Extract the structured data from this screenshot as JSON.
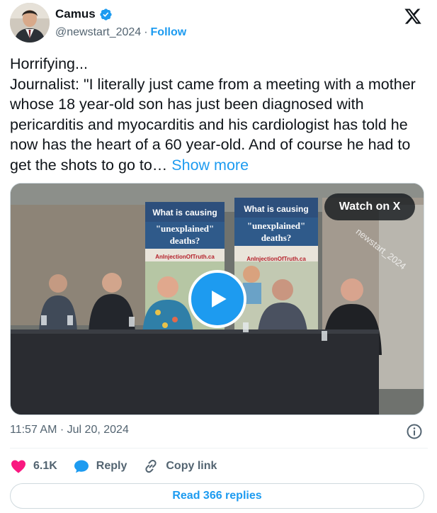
{
  "author": {
    "name": "Camus",
    "handle": "@newstart_2024",
    "separator": "·",
    "follow_label": "Follow"
  },
  "tweet": {
    "line1": "Horrifying...",
    "body": "Journalist: \"I literally just came from a meeting with a mother whose 18 year-old son has just been diagnosed with pericarditis and myocarditis and his cardiologist has told he now has the heart of a 60 year-old. And of course he had to get the shots to go to… ",
    "show_more": "Show more"
  },
  "media": {
    "watch_label": "Watch on X",
    "watermark": "newstart_2024",
    "banner_left": {
      "line1": "What is causing",
      "line2": "\"unexplained\"",
      "line3": "deaths?",
      "url": "AnInjectionOfTruth.ca"
    },
    "banner_right": {
      "line1": "What is causing",
      "line2": "\"unexplained\"",
      "line3": "deaths?",
      "url": "AnInjectionOfTruth.ca"
    }
  },
  "meta": {
    "time": "11:57 AM",
    "separator": "·",
    "date": "Jul 20, 2024"
  },
  "actions": {
    "likes": "6.1K",
    "reply": "Reply",
    "copy_link": "Copy link"
  },
  "read_replies": "Read 366 replies",
  "colors": {
    "accent": "#1d9bf0",
    "like": "#f91880",
    "text": "#0f1419",
    "secondary": "#536471"
  },
  "icons": [
    "verified-badge-icon",
    "x-logo-icon",
    "play-icon",
    "info-icon",
    "heart-icon",
    "reply-bubble-icon",
    "link-icon"
  ]
}
